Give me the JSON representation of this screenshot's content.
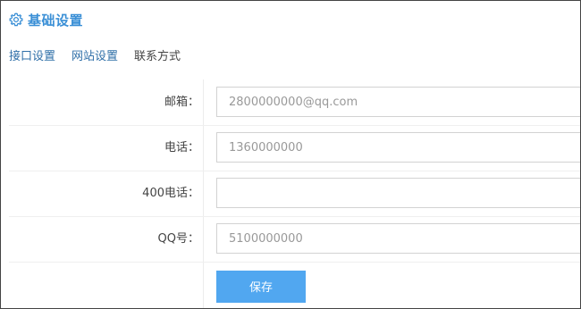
{
  "header": {
    "icon": "gear-icon",
    "title": "基础设置",
    "accent_color": "#3a8fd6"
  },
  "tabs": [
    {
      "label": "接口设置"
    },
    {
      "label": "网站设置"
    },
    {
      "label": "联系方式"
    }
  ],
  "form": {
    "fields": [
      {
        "label": "邮箱：",
        "value": "2800000000@qq.com"
      },
      {
        "label": "电话：",
        "value": "1360000000"
      },
      {
        "label": "400电话：",
        "value": ""
      },
      {
        "label": "QQ号：",
        "value": "5100000000"
      }
    ],
    "save_label": "保存",
    "button_color": "#51a7f0"
  }
}
